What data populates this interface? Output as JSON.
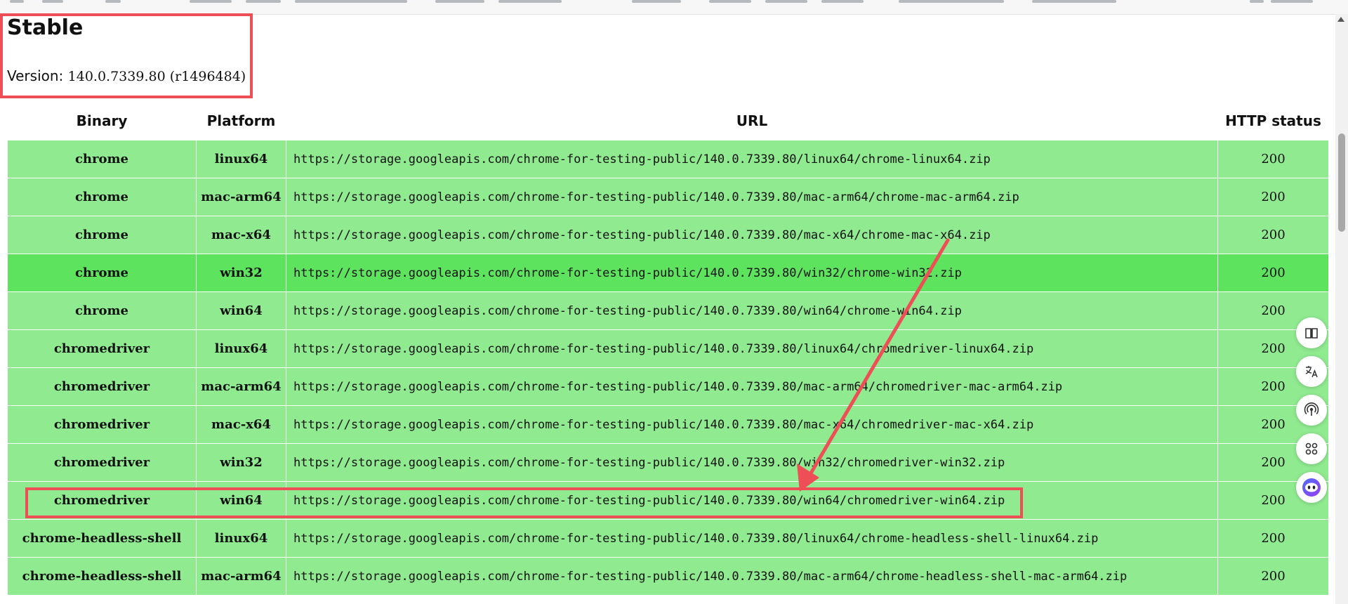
{
  "colors": {
    "row_bg": "#90ea90",
    "row_hover_bg": "#5ee35f",
    "annotation_red": "#ee4e55"
  },
  "heading": {
    "title": "Stable",
    "version_label": "Version:",
    "version_value": "140.0.7339.80 (r1496484)"
  },
  "table": {
    "columns": [
      "Binary",
      "Platform",
      "URL",
      "HTTP status"
    ],
    "rows": [
      {
        "binary": "chrome",
        "platform": "linux64",
        "url": "https://storage.googleapis.com/chrome-for-testing-public/140.0.7339.80/linux64/chrome-linux64.zip",
        "status": "200"
      },
      {
        "binary": "chrome",
        "platform": "mac-arm64",
        "url": "https://storage.googleapis.com/chrome-for-testing-public/140.0.7339.80/mac-arm64/chrome-mac-arm64.zip",
        "status": "200"
      },
      {
        "binary": "chrome",
        "platform": "mac-x64",
        "url": "https://storage.googleapis.com/chrome-for-testing-public/140.0.7339.80/mac-x64/chrome-mac-x64.zip",
        "status": "200"
      },
      {
        "binary": "chrome",
        "platform": "win32",
        "url": "https://storage.googleapis.com/chrome-for-testing-public/140.0.7339.80/win32/chrome-win32.zip",
        "status": "200"
      },
      {
        "binary": "chrome",
        "platform": "win64",
        "url": "https://storage.googleapis.com/chrome-for-testing-public/140.0.7339.80/win64/chrome-win64.zip",
        "status": "200"
      },
      {
        "binary": "chromedriver",
        "platform": "linux64",
        "url": "https://storage.googleapis.com/chrome-for-testing-public/140.0.7339.80/linux64/chromedriver-linux64.zip",
        "status": "200"
      },
      {
        "binary": "chromedriver",
        "platform": "mac-arm64",
        "url": "https://storage.googleapis.com/chrome-for-testing-public/140.0.7339.80/mac-arm64/chromedriver-mac-arm64.zip",
        "status": "200"
      },
      {
        "binary": "chromedriver",
        "platform": "mac-x64",
        "url": "https://storage.googleapis.com/chrome-for-testing-public/140.0.7339.80/mac-x64/chromedriver-mac-x64.zip",
        "status": "200"
      },
      {
        "binary": "chromedriver",
        "platform": "win32",
        "url": "https://storage.googleapis.com/chrome-for-testing-public/140.0.7339.80/win32/chromedriver-win32.zip",
        "status": "200"
      },
      {
        "binary": "chromedriver",
        "platform": "win64",
        "url": "https://storage.googleapis.com/chrome-for-testing-public/140.0.7339.80/win64/chromedriver-win64.zip",
        "status": "200"
      },
      {
        "binary": "chrome-headless-shell",
        "platform": "linux64",
        "url": "https://storage.googleapis.com/chrome-for-testing-public/140.0.7339.80/linux64/chrome-headless-shell-linux64.zip",
        "status": "200"
      },
      {
        "binary": "chrome-headless-shell",
        "platform": "mac-arm64",
        "url": "https://storage.googleapis.com/chrome-for-testing-public/140.0.7339.80/mac-arm64/chrome-headless-shell-mac-arm64.zip",
        "status": "200"
      }
    ]
  },
  "side_tools": [
    "reader-icon",
    "translate-icon",
    "broadcast-icon",
    "apps-icon",
    "assistant-icon"
  ]
}
